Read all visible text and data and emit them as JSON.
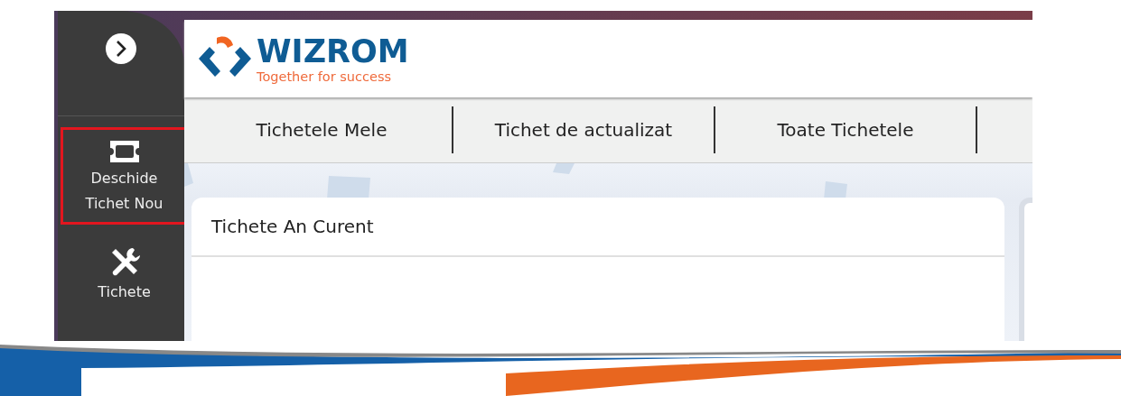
{
  "sidebar": {
    "items": [
      {
        "kind": "toggle",
        "selected": false
      },
      {
        "kind": "ticket",
        "label": "Deschide Tichet Nou",
        "selected": true
      },
      {
        "kind": "tools",
        "label": "Tichete",
        "selected": false
      }
    ]
  },
  "logo": {
    "name": "WIZROM",
    "tagline": "Together for success"
  },
  "tabs": [
    {
      "label": "Tichetele Mele"
    },
    {
      "label": "Tichet de actualizat"
    },
    {
      "label": "Toate Tichetele"
    }
  ],
  "cards": [
    {
      "title": "Tichete An Curent"
    }
  ]
}
